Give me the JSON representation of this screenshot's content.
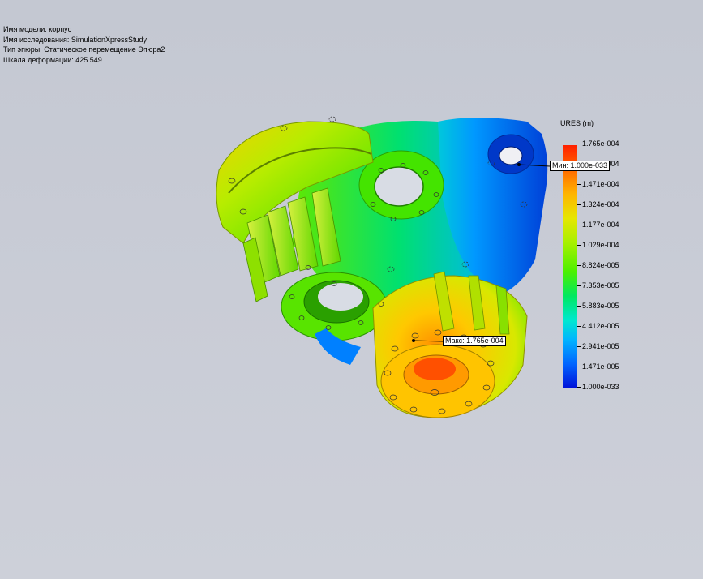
{
  "info": {
    "model_name": "Имя модели: корпус",
    "study_name": "Имя  исследования: SimulationXpressStudy",
    "plot_type": "Тип эпюры: Статическое перемещение Эпюра2",
    "deformation_scale": "Шкала деформации: 425.549"
  },
  "legend": {
    "title": "URES (m)",
    "ticks": [
      "1.765e-004",
      "1.618e-004",
      "1.471e-004",
      "1.324e-004",
      "1.177e-004",
      "1.029e-004",
      "8.824e-005",
      "7.353e-005",
      "5.883e-005",
      "4.412e-005",
      "2.941e-005",
      "1.471e-005",
      "1.000e-033"
    ]
  },
  "probes": {
    "min_label": "Мин: 1.000e-033",
    "max_label": "Макс: 1.765e-004"
  },
  "colors": {
    "background": "#c9ccd6",
    "max_color": "#ff2000",
    "min_color": "#0010d8"
  }
}
